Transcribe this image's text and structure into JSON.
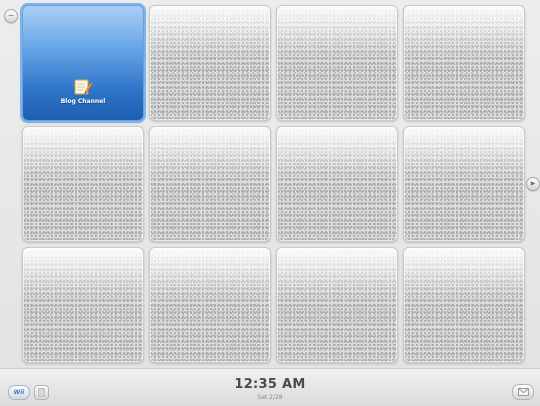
{
  "menu": {
    "channels": [
      {
        "label": "Blog Channel",
        "icon": "notepad-pencil-icon",
        "filled": true
      },
      {
        "label": "",
        "filled": false
      },
      {
        "label": "",
        "filled": false
      },
      {
        "label": "",
        "filled": false
      },
      {
        "label": "",
        "filled": false
      },
      {
        "label": "",
        "filled": false
      },
      {
        "label": "",
        "filled": false
      },
      {
        "label": "",
        "filled": false
      },
      {
        "label": "",
        "filled": false
      },
      {
        "label": "",
        "filled": false
      },
      {
        "label": "",
        "filled": false
      },
      {
        "label": "",
        "filled": false
      }
    ]
  },
  "footer": {
    "time": "12:35 AM",
    "date": "Sat 2/28",
    "wii_button_label": "Wii"
  },
  "colors": {
    "channel_blue": "#2d73c8",
    "background": "#e9e9e9",
    "clock_text": "#4b4b4b"
  }
}
